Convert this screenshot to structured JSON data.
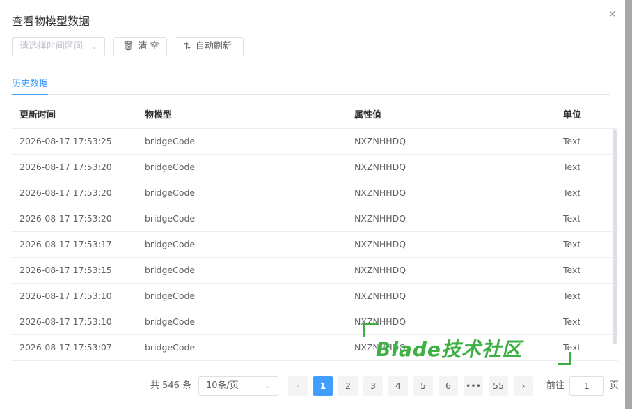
{
  "dialog": {
    "title": "查看物模型数据",
    "close_icon": "close-icon"
  },
  "toolbar": {
    "range_placeholder": "请选择时间区间",
    "clear_label": "清 空",
    "auto_refresh_label": "自动刷新"
  },
  "tabs": [
    {
      "label": "历史数据",
      "active": true
    }
  ],
  "table": {
    "columns": [
      "更新时间",
      "物模型",
      "属性值",
      "单位"
    ],
    "rows": [
      [
        "2026-08-17 17:53:25",
        "bridgeCode",
        "NXZNHHDQ",
        "Text"
      ],
      [
        "2026-08-17 17:53:20",
        "bridgeCode",
        "NXZNHHDQ",
        "Text"
      ],
      [
        "2026-08-17 17:53:20",
        "bridgeCode",
        "NXZNHHDQ",
        "Text"
      ],
      [
        "2026-08-17 17:53:20",
        "bridgeCode",
        "NXZNHHDQ",
        "Text"
      ],
      [
        "2026-08-17 17:53:17",
        "bridgeCode",
        "NXZNHHDQ",
        "Text"
      ],
      [
        "2026-08-17 17:53:15",
        "bridgeCode",
        "NXZNHHDQ",
        "Text"
      ],
      [
        "2026-08-17 17:53:10",
        "bridgeCode",
        "NXZNHHDQ",
        "Text"
      ],
      [
        "2026-08-17 17:53:10",
        "bridgeCode",
        "NXZNHHDQ",
        "Text"
      ],
      [
        "2026-08-17 17:53:07",
        "bridgeCode",
        "NXZNHHDQ",
        "Text"
      ]
    ]
  },
  "pagination": {
    "total": "共 546 条",
    "page_size": "10条/页",
    "pages": [
      "1",
      "2",
      "3",
      "4",
      "5",
      "6",
      "•••",
      "55"
    ],
    "current": "1",
    "goto_label": "前往",
    "goto_value": "1",
    "page_suffix": "页"
  },
  "watermark": "Blade技术社区",
  "colors": {
    "primary": "#409eff",
    "watermark": "#3cb043"
  }
}
